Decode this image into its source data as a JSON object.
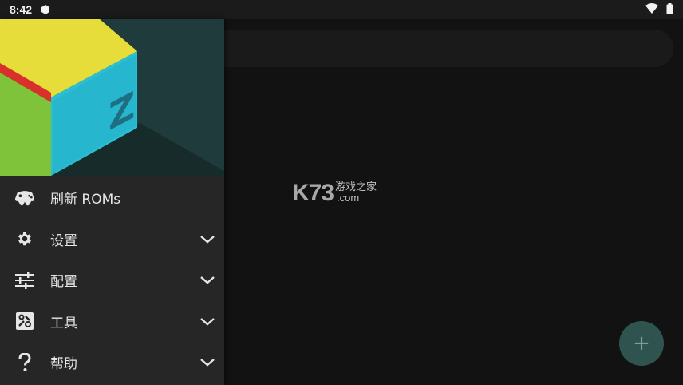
{
  "status_bar": {
    "time": "8:42",
    "icons": [
      "notification-icon",
      "wifi-icon",
      "battery-icon"
    ]
  },
  "main": {
    "watermark": {
      "k73": "K73",
      "cn": "游戏之家",
      "com": ".com"
    },
    "fab_label": "+"
  },
  "drawer": {
    "items": [
      {
        "label": "刷新 ROMs",
        "icon": "gamepad-icon",
        "expandable": false
      },
      {
        "label": "设置",
        "icon": "gear-icon",
        "expandable": true
      },
      {
        "label": "配置",
        "icon": "sliders-icon",
        "expandable": true
      },
      {
        "label": "工具",
        "icon": "tools-icon",
        "expandable": true
      },
      {
        "label": "帮助",
        "icon": "help-icon",
        "expandable": true
      }
    ]
  },
  "colors": {
    "drawer_bg": "#262626",
    "main_bg": "#121212",
    "fab": "#2f5450",
    "header_bg": "#1f3b3b"
  }
}
